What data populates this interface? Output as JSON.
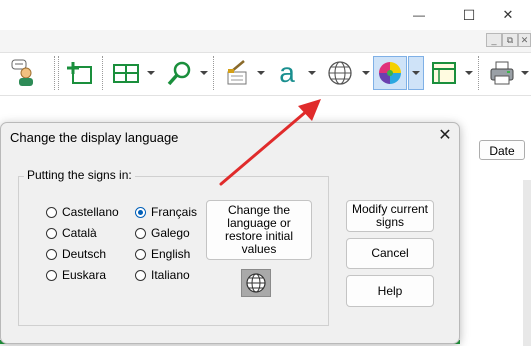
{
  "window_controls": {
    "minimize": "—",
    "maximize": "☐",
    "close": "✕"
  },
  "mdi_controls": {
    "minimize": "_",
    "restore": "⧉",
    "close": "✕"
  },
  "toolbar": {
    "icons": [
      "user-sign-icon",
      "add-frame-icon",
      "grid-layout-icon",
      "zoom-icon",
      "style-brush-icon",
      "font-a-icon",
      "globe-language-icon",
      "color-wheel-icon",
      "table-view-icon",
      "printer-icon"
    ],
    "font_icon_glyph": "a"
  },
  "background": {
    "date_button": "Date"
  },
  "dialog": {
    "title": "Change the display language",
    "close": "✕",
    "group_label": "Putting the signs in:",
    "languages_left": [
      "Castellano",
      "Català",
      "Deutsch",
      "Euskara"
    ],
    "languages_right": [
      "Français",
      "Galego",
      "English",
      "Italiano"
    ],
    "selected_language": "Français",
    "change_button": "Change the language or restore initial values",
    "modify_button": "Modify current signs",
    "cancel_button": "Cancel",
    "help_button": "Help"
  },
  "colors": {
    "accent": "#005fb8",
    "arrow": "#e02b2b",
    "status_green": "#1f9a3c",
    "active_tool": "#cfe3f8"
  }
}
